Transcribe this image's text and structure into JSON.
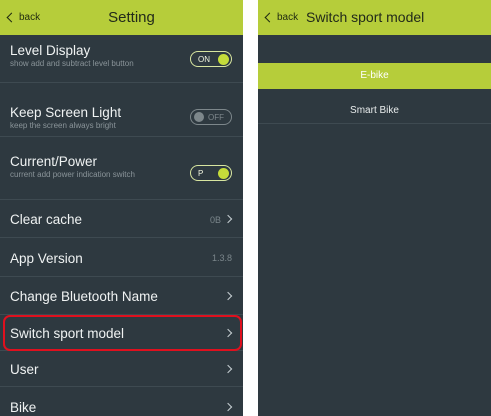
{
  "colors": {
    "accent": "#b6cd3a",
    "panel_bg": "#2e3940",
    "highlight_border": "#e0101e"
  },
  "setting_screen": {
    "back_label": "back",
    "title": "Setting",
    "level_display": {
      "label": "Level Display",
      "description": "show add and subtract level button",
      "toggle_text": "ON",
      "state": "on"
    },
    "keep_screen_light": {
      "label": "Keep Screen Light",
      "description": "keep the screen always bright",
      "toggle_text": "OFF",
      "state": "off"
    },
    "current_power": {
      "label": "Current/Power",
      "description": "current add power indication switch",
      "toggle_text": "P",
      "state": "on"
    },
    "clear_cache": {
      "label": "Clear cache",
      "value": "0B"
    },
    "app_version": {
      "label": "App Version",
      "value": "1.3.8"
    },
    "change_bluetooth_name": {
      "label": "Change Bluetooth Name"
    },
    "switch_sport_model": {
      "label": "Switch sport model",
      "highlighted": true
    },
    "user": {
      "label": "User"
    },
    "bike": {
      "label": "Bike"
    }
  },
  "switch_sport_screen": {
    "back_label": "back",
    "title": "Switch sport model",
    "options": [
      {
        "label": "E-bike",
        "selected": true
      },
      {
        "label": "Smart Bike",
        "selected": false
      }
    ]
  }
}
